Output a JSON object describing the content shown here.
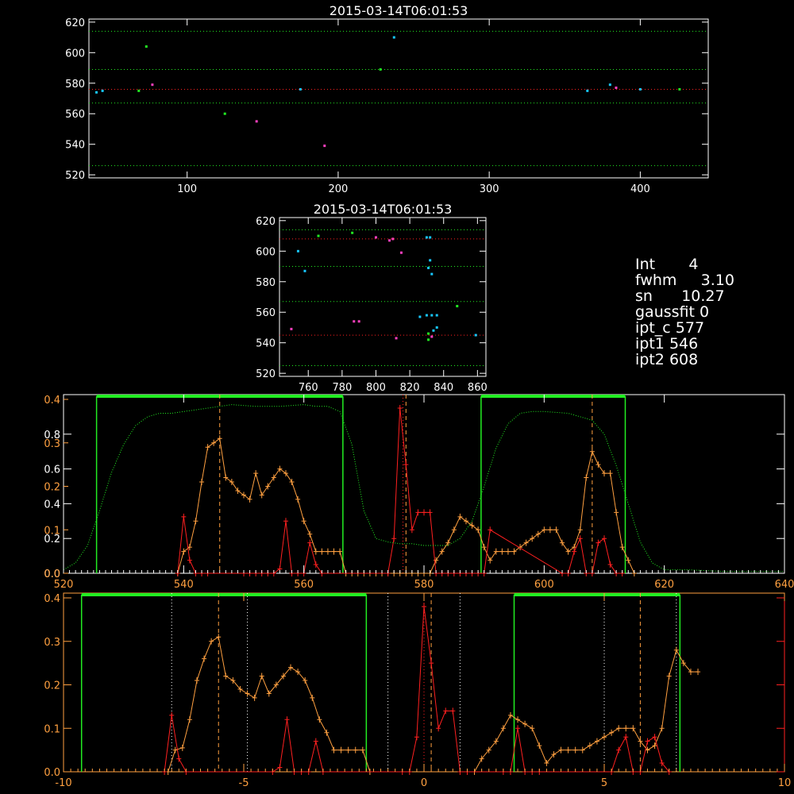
{
  "colors": {
    "white": "#ffffff",
    "orange": "#ffa040",
    "red": "#ff2020",
    "green": "#22ee22",
    "cyan": "#18c8ff",
    "magenta": "#ff40c0"
  },
  "titles": {
    "top": "2015-03-14T06:01:53",
    "middle": "2015-03-14T06:01:53"
  },
  "info": [
    {
      "label": "Int",
      "value": "4"
    },
    {
      "label": "fwhm",
      "value": "3.10"
    },
    {
      "label": "sn",
      "value": "10.27"
    },
    {
      "label": "gaussfit",
      "value": "0"
    },
    {
      "label": "ipt_c",
      "value": "577"
    },
    {
      "label": "ipt1",
      "value": "546"
    },
    {
      "label": "ipt2",
      "value": "608"
    }
  ],
  "chart_data": [
    {
      "type": "scatter",
      "title": "2015-03-14T06:01:53",
      "xlim": [
        35,
        445
      ],
      "ylim": [
        518,
        622
      ],
      "xticks": [
        100,
        200,
        300,
        400
      ],
      "yticks": [
        520,
        540,
        560,
        580,
        600,
        620
      ],
      "hlines": [
        {
          "y": 614,
          "color": "green"
        },
        {
          "y": 589,
          "color": "green"
        },
        {
          "y": 576,
          "color": "red"
        },
        {
          "y": 567,
          "color": "green"
        },
        {
          "y": 526,
          "color": "green"
        }
      ],
      "points": [
        {
          "x": 40,
          "y": 574,
          "c": "cyan"
        },
        {
          "x": 44,
          "y": 575,
          "c": "cyan"
        },
        {
          "x": 68,
          "y": 575,
          "c": "green"
        },
        {
          "x": 73,
          "y": 604,
          "c": "green"
        },
        {
          "x": 77,
          "y": 579,
          "c": "magenta"
        },
        {
          "x": 125,
          "y": 560,
          "c": "green"
        },
        {
          "x": 146,
          "y": 555,
          "c": "magenta"
        },
        {
          "x": 175,
          "y": 576,
          "c": "cyan"
        },
        {
          "x": 191,
          "y": 539,
          "c": "magenta"
        },
        {
          "x": 228,
          "y": 589,
          "c": "green"
        },
        {
          "x": 237,
          "y": 610,
          "c": "cyan"
        },
        {
          "x": 365,
          "y": 575,
          "c": "cyan"
        },
        {
          "x": 380,
          "y": 579,
          "c": "cyan"
        },
        {
          "x": 384,
          "y": 577,
          "c": "magenta"
        },
        {
          "x": 400,
          "y": 576,
          "c": "cyan"
        },
        {
          "x": 426,
          "y": 576,
          "c": "green"
        }
      ]
    },
    {
      "type": "scatter",
      "title": "2015-03-14T06:01:53",
      "xlim": [
        743,
        865
      ],
      "ylim": [
        518,
        622
      ],
      "xticks": [
        760,
        780,
        800,
        820,
        840,
        860
      ],
      "yticks": [
        520,
        540,
        560,
        580,
        600,
        620
      ],
      "hlines": [
        {
          "y": 614,
          "color": "green"
        },
        {
          "y": 608,
          "color": "red"
        },
        {
          "y": 590,
          "color": "green"
        },
        {
          "y": 567,
          "color": "green"
        },
        {
          "y": 545,
          "color": "red"
        },
        {
          "y": 525,
          "color": "green"
        }
      ],
      "points": [
        {
          "x": 750,
          "y": 549,
          "c": "magenta"
        },
        {
          "x": 754,
          "y": 600,
          "c": "cyan"
        },
        {
          "x": 758,
          "y": 587,
          "c": "cyan"
        },
        {
          "x": 766,
          "y": 610,
          "c": "green"
        },
        {
          "x": 786,
          "y": 612,
          "c": "green"
        },
        {
          "x": 787,
          "y": 554,
          "c": "magenta"
        },
        {
          "x": 790,
          "y": 554,
          "c": "magenta"
        },
        {
          "x": 800,
          "y": 609,
          "c": "magenta"
        },
        {
          "x": 808,
          "y": 607,
          "c": "magenta"
        },
        {
          "x": 810,
          "y": 608,
          "c": "magenta"
        },
        {
          "x": 812,
          "y": 543,
          "c": "magenta"
        },
        {
          "x": 815,
          "y": 599,
          "c": "magenta"
        },
        {
          "x": 826,
          "y": 557,
          "c": "cyan"
        },
        {
          "x": 830,
          "y": 609,
          "c": "cyan"
        },
        {
          "x": 832,
          "y": 609,
          "c": "cyan"
        },
        {
          "x": 831,
          "y": 589,
          "c": "cyan"
        },
        {
          "x": 832,
          "y": 594,
          "c": "cyan"
        },
        {
          "x": 833,
          "y": 585,
          "c": "cyan"
        },
        {
          "x": 830,
          "y": 558,
          "c": "cyan"
        },
        {
          "x": 833,
          "y": 558,
          "c": "cyan"
        },
        {
          "x": 836,
          "y": 558,
          "c": "cyan"
        },
        {
          "x": 836,
          "y": 550,
          "c": "cyan"
        },
        {
          "x": 834,
          "y": 548,
          "c": "cyan"
        },
        {
          "x": 831,
          "y": 546,
          "c": "green"
        },
        {
          "x": 831,
          "y": 542,
          "c": "green"
        },
        {
          "x": 833,
          "y": 544,
          "c": "magenta"
        },
        {
          "x": 848,
          "y": 564,
          "c": "green"
        },
        {
          "x": 859,
          "y": 545,
          "c": "cyan"
        }
      ]
    },
    {
      "type": "line",
      "xlim": [
        520,
        640
      ],
      "xticks": [
        520,
        540,
        560,
        580,
        600,
        620,
        640
      ],
      "yticks_left": [
        0.0,
        0.2,
        0.4,
        0.6,
        0.8
      ],
      "yticks_left2": [
        0.0,
        0.1,
        0.2,
        0.3,
        0.4
      ],
      "y_secondary_max": 0.4,
      "windows": [
        [
          525.5,
          566.5
        ],
        [
          589.5,
          613.5
        ]
      ],
      "vlines": [
        {
          "x": 546,
          "color": "orange",
          "dash": "5,4"
        },
        {
          "x": 576.5,
          "color": "red",
          "dash": "1,3"
        },
        {
          "x": 577,
          "color": "orange",
          "dash": "5,4"
        },
        {
          "x": 608,
          "color": "orange",
          "dash": "5,4"
        }
      ],
      "series": [
        {
          "color": "orange",
          "markers": true,
          "x": [
            539,
            540,
            541,
            542,
            543,
            544,
            545,
            546,
            547,
            548,
            549,
            550,
            551,
            552,
            553,
            554,
            555,
            556,
            557,
            558,
            559,
            560,
            561,
            562,
            563,
            564,
            565,
            566,
            567,
            568,
            569,
            570,
            571,
            572,
            573,
            574,
            575,
            576,
            577,
            578,
            579,
            580,
            581,
            582,
            583,
            584,
            585,
            586,
            587,
            588,
            589,
            590,
            591,
            592,
            593,
            594,
            595,
            596,
            597,
            598,
            599,
            600,
            601,
            602,
            603,
            604,
            605,
            606,
            607,
            608,
            609,
            610,
            611,
            612,
            613,
            614,
            615
          ],
          "y": [
            0.0,
            0.05,
            0.06,
            0.12,
            0.21,
            0.29,
            0.3,
            0.31,
            0.22,
            0.21,
            0.19,
            0.18,
            0.17,
            0.23,
            0.18,
            0.2,
            0.22,
            0.24,
            0.23,
            0.21,
            0.17,
            0.12,
            0.09,
            0.05,
            0.05,
            0.05,
            0.05,
            0.05,
            0.0,
            0.0,
            0.0,
            0.0,
            0.0,
            0.0,
            0.0,
            0.0,
            0.0,
            0.0,
            0.0,
            0.0,
            0.0,
            0.0,
            0.0,
            0.03,
            0.05,
            0.07,
            0.1,
            0.13,
            0.12,
            0.11,
            0.1,
            0.06,
            0.03,
            0.05,
            0.05,
            0.05,
            0.05,
            0.06,
            0.07,
            0.08,
            0.09,
            0.1,
            0.1,
            0.1,
            0.07,
            0.05,
            0.06,
            0.1,
            0.22,
            0.28,
            0.25,
            0.23,
            0.23,
            0.14,
            0.06,
            0.03,
            0.0
          ]
        },
        {
          "color": "red",
          "markers": true,
          "x": [
            539,
            540,
            541,
            542,
            543,
            544,
            550,
            551,
            552,
            553,
            554,
            555,
            556,
            557,
            558,
            559,
            560,
            561,
            562,
            563,
            574,
            575,
            576,
            577,
            578,
            579,
            580,
            581,
            582,
            583,
            584,
            585,
            586,
            587,
            588,
            589,
            590,
            591,
            603,
            604,
            605,
            606,
            607,
            608,
            609,
            610,
            611,
            612,
            613
          ],
          "y": [
            0.0,
            0.13,
            0.03,
            0.0,
            0.0,
            0.0,
            0.0,
            0.0,
            0.0,
            0.0,
            0.0,
            0.0,
            0.01,
            0.12,
            0.0,
            0.0,
            0.0,
            0.07,
            0.02,
            0.0,
            0.0,
            0.08,
            0.38,
            0.25,
            0.1,
            0.14,
            0.14,
            0.14,
            0.0,
            0.0,
            0.0,
            0.0,
            0.0,
            0.0,
            0.0,
            0.0,
            0.0,
            0.1,
            0.0,
            0.0,
            0.05,
            0.08,
            0.0,
            0.0,
            0.07,
            0.08,
            0.02,
            0.0,
            0.0
          ]
        },
        {
          "color": "green",
          "markers": false,
          "dotted": true,
          "axis": "left",
          "x": [
            520,
            522,
            524,
            526,
            528,
            530,
            532,
            534,
            536,
            538,
            540,
            544,
            548,
            552,
            556,
            560,
            562,
            564,
            566,
            568,
            570,
            572,
            574,
            576,
            578,
            580,
            582,
            584,
            586,
            588,
            590,
            592,
            594,
            596,
            598,
            600,
            604,
            608,
            610,
            612,
            614,
            616,
            618,
            620,
            624,
            630,
            640
          ],
          "y": [
            0.02,
            0.06,
            0.16,
            0.36,
            0.58,
            0.74,
            0.85,
            0.9,
            0.92,
            0.92,
            0.93,
            0.95,
            0.97,
            0.96,
            0.96,
            0.97,
            0.96,
            0.96,
            0.93,
            0.74,
            0.36,
            0.2,
            0.18,
            0.17,
            0.17,
            0.16,
            0.16,
            0.16,
            0.2,
            0.3,
            0.5,
            0.72,
            0.86,
            0.92,
            0.93,
            0.93,
            0.92,
            0.88,
            0.8,
            0.62,
            0.4,
            0.18,
            0.06,
            0.02,
            0.02,
            0.01,
            0.01
          ]
        }
      ]
    },
    {
      "type": "line",
      "xlim": [
        -10,
        10
      ],
      "xticks": [
        -10,
        -5,
        0,
        5,
        10
      ],
      "yticks": [
        0.0,
        0.1,
        0.2,
        0.3,
        0.4
      ],
      "ylim": [
        0,
        0.4
      ],
      "windows": [
        [
          -9.5,
          -1.6
        ],
        [
          2.5,
          7.1
        ]
      ],
      "vlines": [
        {
          "x": -7,
          "color": "white",
          "dash": "1,3"
        },
        {
          "x": -5.7,
          "color": "orange",
          "dash": "5,4"
        },
        {
          "x": -4.9,
          "color": "white",
          "dash": "1,3"
        },
        {
          "x": -1,
          "color": "white",
          "dash": "1,3"
        },
        {
          "x": 0,
          "color": "red",
          "dash": "1,3"
        },
        {
          "x": 0.2,
          "color": "orange",
          "dash": "5,4"
        },
        {
          "x": 1,
          "color": "white",
          "dash": "1,3"
        },
        {
          "x": 5,
          "color": "white",
          "dash": "1,3"
        },
        {
          "x": 6,
          "color": "orange",
          "dash": "5,4"
        },
        {
          "x": 7,
          "color": "white",
          "dash": "1,3"
        }
      ],
      "series": [
        {
          "color": "orange",
          "markers": true,
          "x": [
            -7.1,
            -6.9,
            -6.7,
            -6.5,
            -6.3,
            -6.1,
            -5.9,
            -5.7,
            -5.5,
            -5.3,
            -5.1,
            -4.9,
            -4.7,
            -4.5,
            -4.3,
            -4.1,
            -3.9,
            -3.7,
            -3.5,
            -3.3,
            -3.1,
            -2.9,
            -2.7,
            -2.5,
            -2.3,
            -2.1,
            -1.9,
            -1.7,
            -1.5,
            1.4,
            1.6,
            1.8,
            2.0,
            2.2,
            2.4,
            2.6,
            2.8,
            3.0,
            3.2,
            3.4,
            3.6,
            3.8,
            4.0,
            4.2,
            4.4,
            4.6,
            4.8,
            5.0,
            5.2,
            5.4,
            5.6,
            5.8,
            6.0,
            6.2,
            6.4,
            6.6,
            6.8,
            7.0,
            7.2,
            7.4,
            7.6
          ],
          "y": [
            0.0,
            0.05,
            0.055,
            0.12,
            0.21,
            0.26,
            0.3,
            0.31,
            0.22,
            0.21,
            0.19,
            0.18,
            0.17,
            0.22,
            0.18,
            0.2,
            0.22,
            0.24,
            0.23,
            0.21,
            0.17,
            0.12,
            0.09,
            0.05,
            0.05,
            0.05,
            0.05,
            0.05,
            0.0,
            0.0,
            0.03,
            0.05,
            0.07,
            0.1,
            0.13,
            0.12,
            0.11,
            0.1,
            0.06,
            0.02,
            0.04,
            0.05,
            0.05,
            0.05,
            0.05,
            0.06,
            0.07,
            0.08,
            0.09,
            0.1,
            0.1,
            0.1,
            0.07,
            0.05,
            0.06,
            0.1,
            0.22,
            0.28,
            0.25,
            0.23,
            0.23
          ]
        },
        {
          "color": "red",
          "markers": true,
          "x": [
            -7.2,
            -7.0,
            -6.8,
            -6.6,
            -4.2,
            -4.0,
            -3.8,
            -3.6,
            -3.4,
            -3.2,
            -3.0,
            -2.8,
            -0.6,
            -0.4,
            -0.2,
            0.0,
            0.2,
            0.4,
            0.6,
            0.8,
            1.0,
            1.2,
            2.2,
            2.4,
            2.6,
            2.8,
            3.0,
            3.2,
            5.2,
            5.4,
            5.6,
            5.8,
            6.0,
            6.2,
            6.4,
            6.6,
            6.8
          ],
          "y": [
            0.0,
            0.13,
            0.03,
            0.0,
            0.0,
            0.01,
            0.12,
            0.0,
            0.0,
            0.0,
            0.07,
            0.0,
            0.0,
            0.0,
            0.08,
            0.38,
            0.25,
            0.1,
            0.14,
            0.14,
            0.0,
            0.0,
            0.0,
            0.0,
            0.1,
            0.0,
            0.0,
            0.0,
            0.0,
            0.05,
            0.08,
            0.0,
            0.0,
            0.07,
            0.08,
            0.02,
            0.0
          ]
        }
      ]
    }
  ]
}
